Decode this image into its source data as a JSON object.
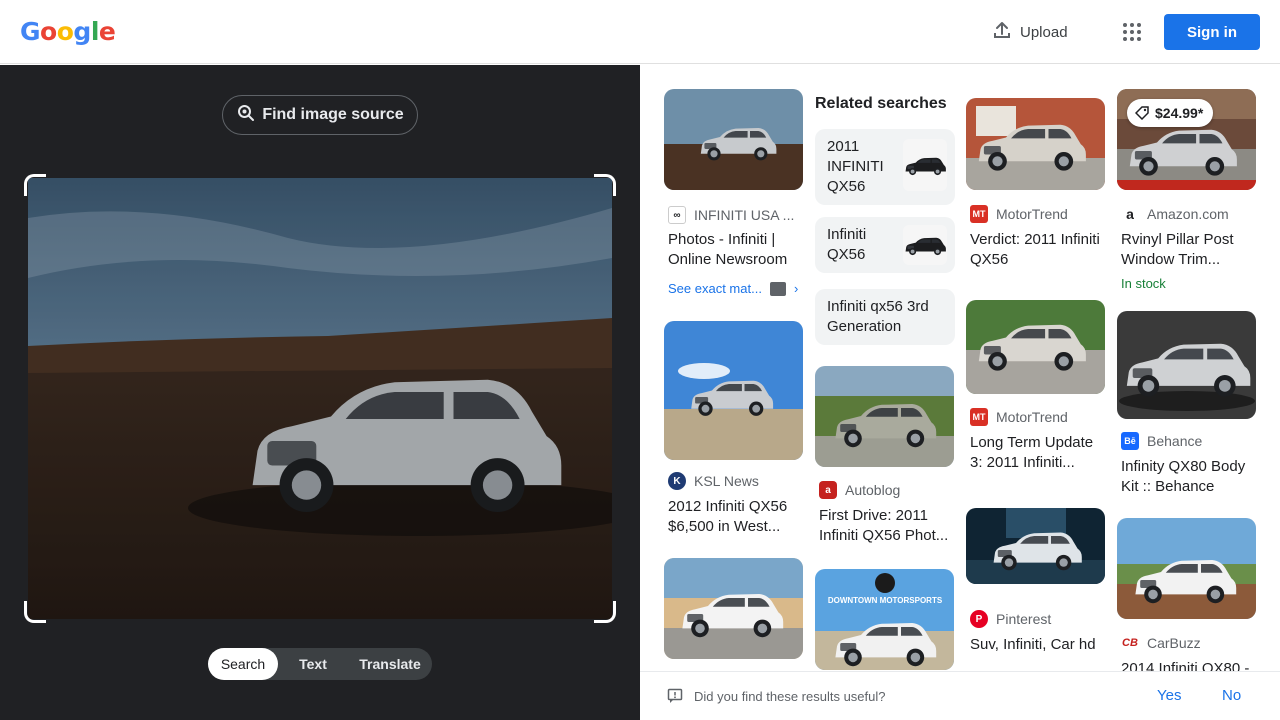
{
  "header": {
    "logo_letters": [
      {
        "ch": "G",
        "color": "#4285F4"
      },
      {
        "ch": "o",
        "color": "#EA4335"
      },
      {
        "ch": "o",
        "color": "#FBBC05"
      },
      {
        "ch": "g",
        "color": "#4285F4"
      },
      {
        "ch": "l",
        "color": "#34A853"
      },
      {
        "ch": "e",
        "color": "#EA4335"
      }
    ],
    "upload_label": "Upload",
    "signin_label": "Sign in",
    "icons": [
      "upload-icon",
      "apps-grid-icon"
    ]
  },
  "lens": {
    "find_source_label": "Find image source",
    "tabs": [
      "Search",
      "Text",
      "Translate"
    ],
    "active_tab": "Search"
  },
  "results": {
    "related_title": "Related searches",
    "related": [
      {
        "label": "2011 INFINITI QX56",
        "has_thumb": true
      },
      {
        "label": "Infiniti QX56",
        "has_thumb": true
      },
      {
        "label": "Infiniti qx56 3rd Generation",
        "has_thumb": false
      }
    ],
    "cards": [
      {
        "source": "INFINITI USA ...",
        "icon": "infiniti-logo-icon",
        "title": "Photos - Infiniti | Online Newsroom",
        "see_exact": "See exact mat..."
      },
      {
        "source": "KSL News",
        "icon": "ksl-logo-icon",
        "title": "2012 Infiniti QX56 $6,500 in West..."
      },
      {
        "source": "Autoblog",
        "icon": "autoblog-logo-icon",
        "title": "First Drive: 2011 Infiniti QX56 Phot..."
      },
      {
        "source": "MotorTrend",
        "icon": "motortrend-logo-icon",
        "title": "Verdict: 2011 Infiniti QX56"
      },
      {
        "source": "MotorTrend",
        "icon": "motortrend-logo-icon",
        "title": "Long Term Update 3: 2011 Infiniti..."
      },
      {
        "source": "Pinterest",
        "icon": "pinterest-logo-icon",
        "title": "Suv, Infiniti, Car hd"
      },
      {
        "source": "Amazon.com",
        "icon": "amazon-logo-icon",
        "title": "Rvinyl Pillar Post Window Trim...",
        "price": "$24.99*",
        "stock": "In stock"
      },
      {
        "source": "Behance",
        "icon": "behance-logo-icon",
        "title": "Infinity QX80 Body Kit :: Behance"
      },
      {
        "source": "CarBuzz",
        "icon": "carbuzz-logo-icon",
        "title": "2014 Infiniti QX80 -"
      }
    ],
    "watermark_text": "DOWNTOWN MOTORSPORTS"
  },
  "feedback": {
    "question": "Did you find these results useful?",
    "yes": "Yes",
    "no": "No"
  },
  "colors": {
    "accent": "#1a73e8",
    "dark_bg": "#202124",
    "stock_green": "#188038"
  }
}
